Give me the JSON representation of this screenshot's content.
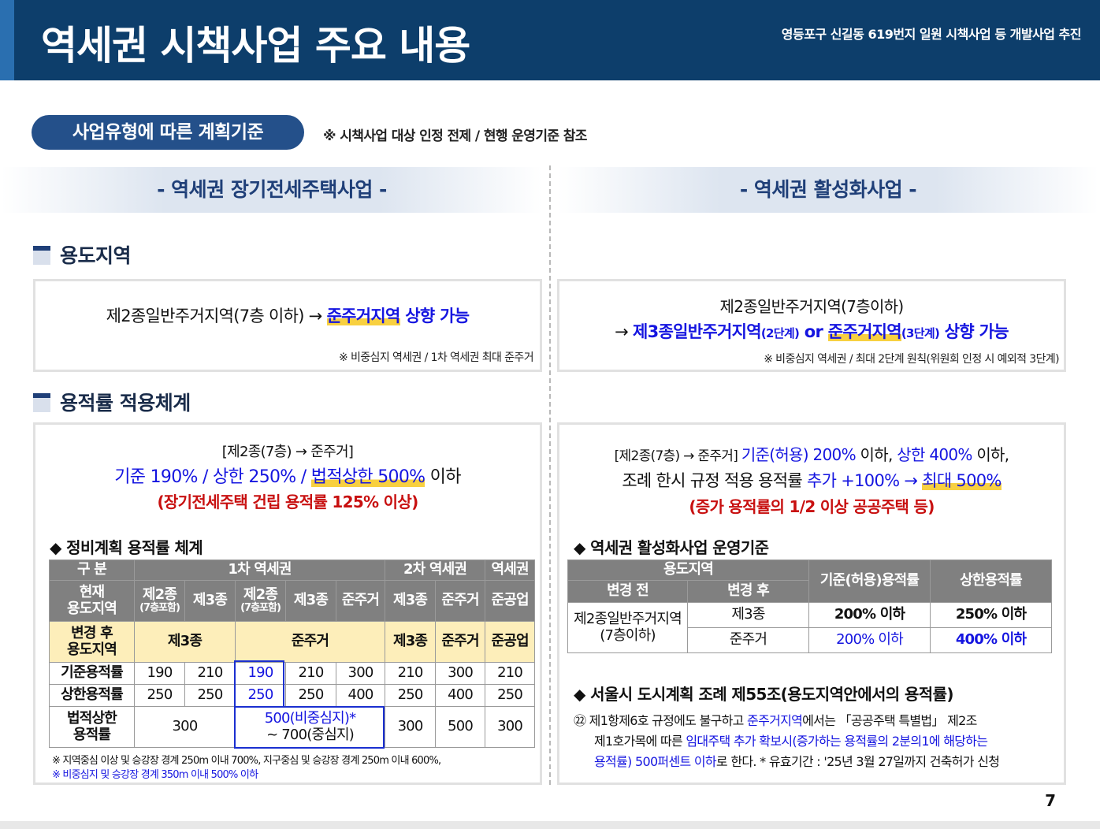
{
  "header": {
    "title": "역세권 시책사업 주요 내용",
    "subtitle": "영등포구 신길동 619번지 일원 시책사업 등 개발사업 추진"
  },
  "pill": {
    "label": "사업유형에 따른 계획기준",
    "note": "※ 시책사업 대상 인정 전제 / 현행 운영기준 참조"
  },
  "left": {
    "title": "- 역세권 장기전세주택사업 -",
    "zoning_heading": "용도지역",
    "zoning_line_prefix": "제2종일반주거지역(7층 이하) → ",
    "zoning_line_hl": "준주거지역",
    "zoning_line_suffix": " 상향 가능",
    "zoning_note": "※ 비중심지 역세권 / 1차 역세권 최대 준주거",
    "far_heading": "용적률 적용체계",
    "far_line1": "[제2종(7층) → 준주거]",
    "far_line2_a": "기준 190% / 상한 250% / ",
    "far_line2_hl": "법적상한 500%",
    "far_line2_b": " 이하",
    "far_line3": "(장기전세주택 건립 용적률 125% 이상)",
    "table_title": "◆ 정비계획 용적률 체계",
    "table": {
      "h_gubun": "구 분",
      "h_1st": "1차 역세권",
      "h_2nd": "2차 역세권",
      "h_area": "역세권",
      "row_current": "현재\n용도지역",
      "cur_cols": [
        "제2종",
        "(7층포함)",
        "제3종",
        "제2종",
        "(7층포함)",
        "제3종",
        "준주거",
        "제3종",
        "준주거",
        "준공업"
      ],
      "row_after": "변경 후\n용도지역",
      "after_cols": [
        "제3종",
        "준주거",
        "제3종",
        "준주거",
        "준공업"
      ],
      "row_base": "기준용적률",
      "base_vals": [
        "190",
        "210",
        "190",
        "210",
        "300",
        "210",
        "300",
        "210"
      ],
      "row_upper": "상한용적률",
      "upper_vals": [
        "250",
        "250",
        "250",
        "250",
        "400",
        "250",
        "400",
        "250"
      ],
      "row_legal": "법적상한\n용적률",
      "legal_vals": [
        "300",
        "500(비중심지)*",
        "~ 700(중심지)",
        "300",
        "500",
        "300"
      ]
    },
    "foot1": "※ 지역중심 이상 및 승강장 경계 250m 이내 700%, 지구중심 및 승강장 경계 250m 이내 600%,",
    "foot2": "※ 비중심지 및 승강장 경계 350m 이내 500% 이하"
  },
  "right": {
    "title": "- 역세권 활성화사업 -",
    "zoning_line1": "제2종일반주거지역(7층이하)",
    "zoning_line2_a": "→ ",
    "zoning_line2_b": "제3종일반주거지역",
    "zoning_line2_b_small": "(2단계)",
    "zoning_line2_or": " or ",
    "zoning_line2_hl": "준주거지역",
    "zoning_line2_hl_small": "(3단계)",
    "zoning_line2_c": " 상향 가능",
    "zoning_note": "※ 비중심지 역세권 / 최대 2단계 원칙(위원회 인정 시 예외적 3단계)",
    "far_line1_a": "[제2종(7층) → 준주거] ",
    "far_line1_b": "기준(허용) 200%",
    "far_line1_c": " 이하, ",
    "far_line1_d": "상한 400%",
    "far_line1_e": " 이하,",
    "far_line2_a": "조례 한시 규정 적용 용적률 ",
    "far_line2_b": "추가 +100% → ",
    "far_line2_hl": "최대 500%",
    "far_line3": "(증가 용적률의 1/2 이상 공공주택 등)",
    "table_title": "◆ 역세권 활성화사업 운영기준",
    "table": {
      "h_zone": "용도지역",
      "h_before": "변경 전",
      "h_after": "변경 후",
      "h_base": "기준(허용)용적률",
      "h_upper": "상한용적률",
      "before_val": "제2종일반주거지역\n(7층이하)",
      "rows": [
        {
          "after": "제3종",
          "base": "200% 이하",
          "upper": "250% 이하"
        },
        {
          "after": "준주거",
          "base": "200% 이하",
          "upper": "400% 이하"
        }
      ]
    },
    "ord_title": "◆ 서울시 도시계획 조례 제55조(용도지역안에서의 용적률)",
    "ord_line1_a": "㉒ 제1항제6호 규정에도 불구하고 ",
    "ord_line1_b": "준주거지역",
    "ord_line1_c": "에서는 「공공주택 특별법」 제2조",
    "ord_line2_a": "제1호가목에 따른 ",
    "ord_line2_b": "임대주택 추가 확보시(증가하는 용적률의 2분의1에 해당하는",
    "ord_line3_a": "용적률) 500퍼센트 이하",
    "ord_line3_b": "로 한다. * 유효기간 : '25년 3월 27일까지 건축허가 신청"
  },
  "page_number": "7",
  "colors": {
    "header": "#0d3e6b",
    "accent_blue": "#1515e0",
    "accent_red": "#c81010",
    "highlight": "#f8d040",
    "table_header": "#808080",
    "table_yellow": "#fdeeba"
  }
}
